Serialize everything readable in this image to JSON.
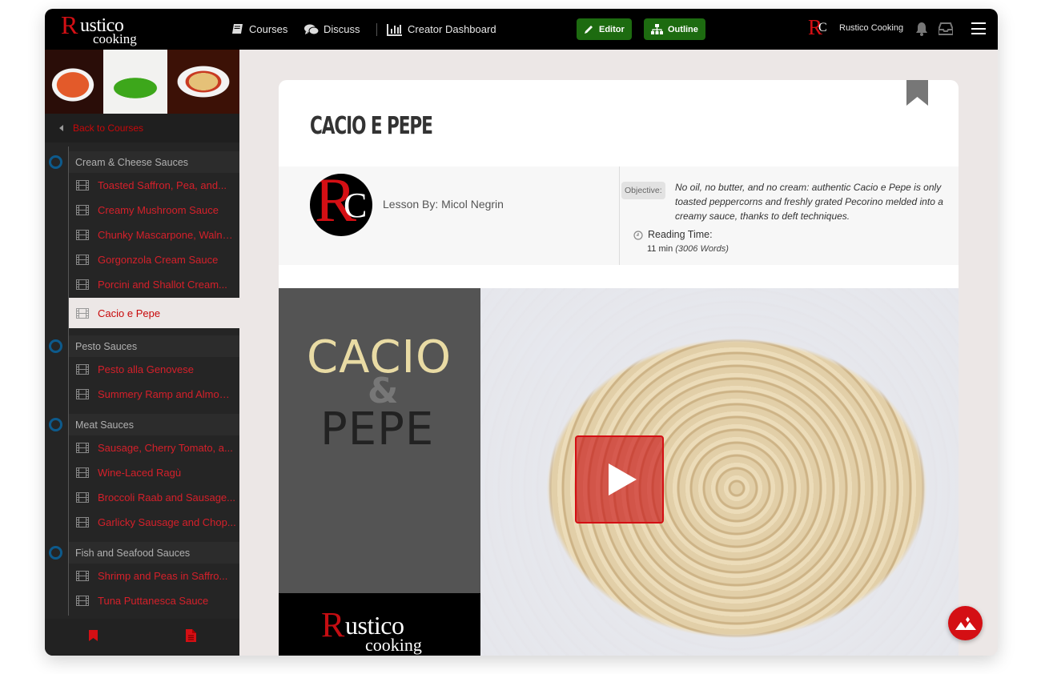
{
  "brand": {
    "logo_initial": "R",
    "logo_rest": "ustico",
    "logo_sub": "cooking",
    "accent_color": "#d40f14",
    "button_color": "#1d6b10"
  },
  "topbar": {
    "nav": [
      {
        "label": "Courses",
        "icon": "book-icon"
      },
      {
        "label": "Discuss",
        "icon": "comments-icon"
      },
      {
        "label": "Creator Dashboard",
        "icon": "bar-chart-icon"
      }
    ],
    "editor_label": "Editor",
    "outline_label": "Outline",
    "account_initials_r": "R",
    "account_initials_c": "C",
    "account_name": "Rustico Cooking"
  },
  "sidebar": {
    "back_label": "Back to Courses",
    "sections": [
      {
        "title": "Cream & Cheese Sauces",
        "lessons": [
          "Toasted Saffron, Pea, and...",
          "Creamy Mushroom Sauce",
          "Chunky Mascarpone, Waln…",
          "Gorgonzola Cream Sauce",
          "Porcini and Shallot Cream...",
          "Cacio e Pepe"
        ]
      },
      {
        "title": "Pesto Sauces",
        "lessons": [
          "Pesto alla Genovese",
          "Summery Ramp and Almo…"
        ]
      },
      {
        "title": "Meat Sauces",
        "lessons": [
          "Sausage, Cherry Tomato, a...",
          "Wine-Laced Ragù",
          "Broccoli Raab and Sausage...",
          "Garlicky Sausage and Chop..."
        ]
      },
      {
        "title": "Fish and Seafood Sauces",
        "lessons": [
          "Shrimp and Peas in Saffro...",
          "Tuna Puttanesca Sauce"
        ]
      }
    ],
    "active_lesson": "Cacio e Pepe"
  },
  "lesson": {
    "title": "CACIO E PEPE",
    "author_label": "Lesson By: Micol Negrin",
    "objective_label": "Objective:",
    "objective_text": "No oil, no butter, and no cream: authentic Cacio e Pepe is only toasted peppercorns and freshly grated Pecorino melded into a creamy sauce, thanks to deft techniques.",
    "reading_time_label": "Reading Time:",
    "reading_time_value": "11 min",
    "reading_time_words": "(3006 Words)"
  },
  "video": {
    "poster_word1": "CACIO",
    "poster_amp": "&",
    "poster_word2": "PEPE",
    "poster_brand_initial": "R",
    "poster_brand_rest": "ustico",
    "poster_brand_sub": "cooking"
  }
}
